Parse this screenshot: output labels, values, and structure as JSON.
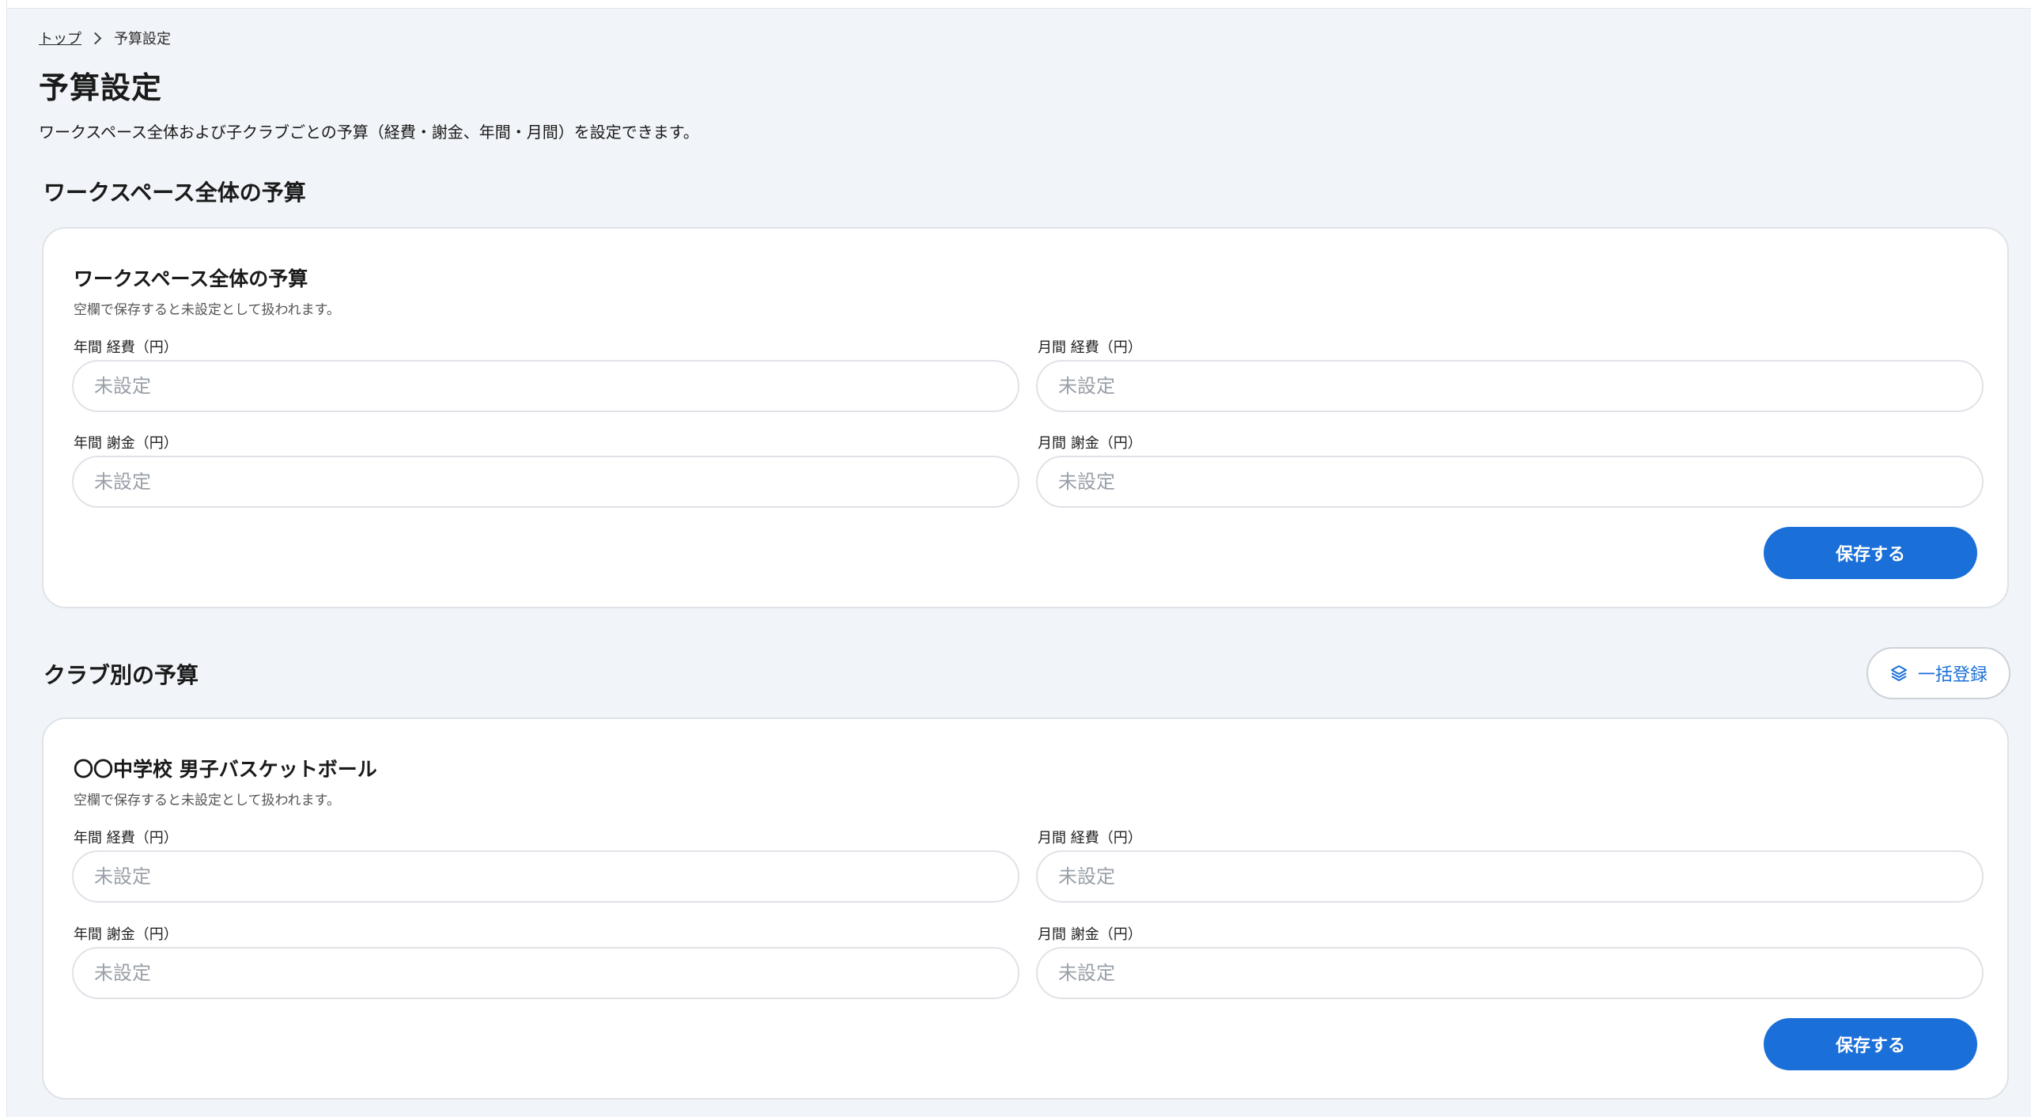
{
  "breadcrumb": {
    "home": "トップ",
    "current": "予算設定"
  },
  "page": {
    "title": "予算設定",
    "description": "ワークスペース全体および子クラブごとの予算（経費・謝金、年間・月間）を設定できます。"
  },
  "workspace_section": {
    "title": "ワークスペース全体の予算",
    "card": {
      "title": "ワークスペース全体の予算",
      "note": "空欄で保存すると未設定として扱われます。",
      "fields": {
        "annual_expense": {
          "label": "年間 経費（円）",
          "placeholder": "未設定",
          "value": ""
        },
        "monthly_expense": {
          "label": "月間 経費（円）",
          "placeholder": "未設定",
          "value": ""
        },
        "annual_fee": {
          "label": "年間 謝金（円）",
          "placeholder": "未設定",
          "value": ""
        },
        "monthly_fee": {
          "label": "月間 謝金（円）",
          "placeholder": "未設定",
          "value": ""
        }
      },
      "save_label": "保存する"
    }
  },
  "club_section": {
    "title": "クラブ別の予算",
    "bulk_label": "一括登録",
    "bulk_icon": "layers-icon",
    "clubs": [
      {
        "title": "〇〇中学校 男子バスケットボール",
        "note": "空欄で保存すると未設定として扱われます。",
        "fields": {
          "annual_expense": {
            "label": "年間 経費（円）",
            "placeholder": "未設定",
            "value": ""
          },
          "monthly_expense": {
            "label": "月間 経費（円）",
            "placeholder": "未設定",
            "value": ""
          },
          "annual_fee": {
            "label": "年間 謝金（円）",
            "placeholder": "未設定",
            "value": ""
          },
          "monthly_fee": {
            "label": "月間 謝金（円）",
            "placeholder": "未設定",
            "value": ""
          }
        },
        "save_label": "保存する"
      }
    ]
  },
  "colors": {
    "accent": "#1a6fd8",
    "background": "#f1f4f8",
    "card": "#ffffff",
    "border": "#dfe3e8"
  }
}
